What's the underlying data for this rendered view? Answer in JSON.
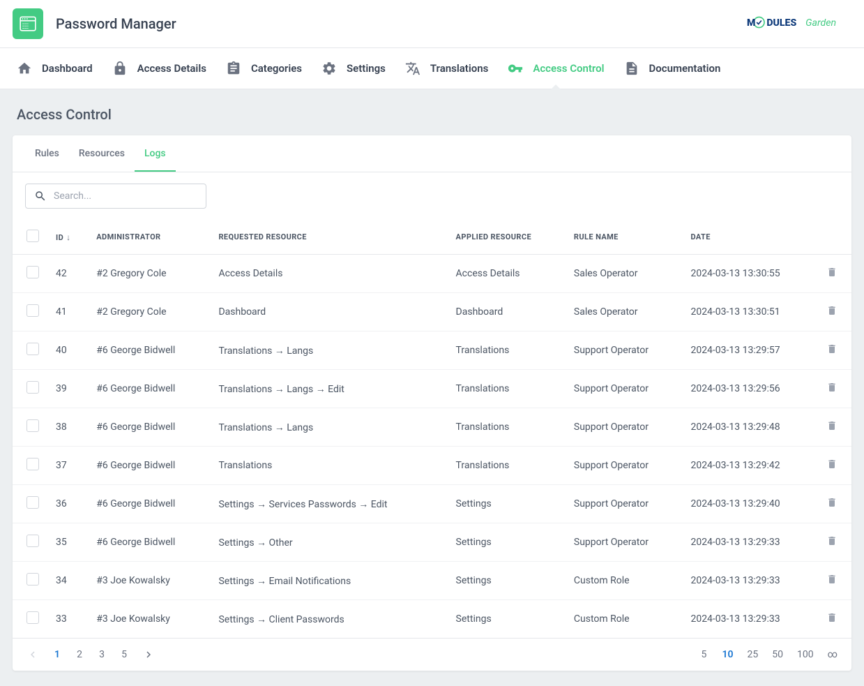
{
  "header": {
    "title": "Password Manager",
    "brand_modules": "MODULES",
    "brand_garden": "Garden"
  },
  "nav": {
    "items": [
      {
        "label": "Dashboard",
        "key": "dashboard"
      },
      {
        "label": "Access Details",
        "key": "access-details"
      },
      {
        "label": "Categories",
        "key": "categories"
      },
      {
        "label": "Settings",
        "key": "settings"
      },
      {
        "label": "Translations",
        "key": "translations"
      },
      {
        "label": "Access Control",
        "key": "access-control",
        "active": true
      },
      {
        "label": "Documentation",
        "key": "documentation"
      }
    ]
  },
  "page": {
    "title": "Access Control"
  },
  "tabs": {
    "items": [
      {
        "label": "Rules"
      },
      {
        "label": "Resources"
      },
      {
        "label": "Logs",
        "active": true
      }
    ]
  },
  "search": {
    "placeholder": "Search..."
  },
  "table": {
    "headers": {
      "id": "ID",
      "admin": "ADMINISTRATOR",
      "req": "REQUESTED RESOURCE",
      "app": "APPLIED RESOURCE",
      "rule": "RULE NAME",
      "date": "DATE"
    },
    "rows": [
      {
        "id": "42",
        "admin": "#2 Gregory Cole",
        "req": "Access Details",
        "app": "Access Details",
        "rule": "Sales Operator",
        "date": "2024-03-13 13:30:55"
      },
      {
        "id": "41",
        "admin": "#2 Gregory Cole",
        "req": "Dashboard",
        "app": "Dashboard",
        "rule": "Sales Operator",
        "date": "2024-03-13 13:30:51"
      },
      {
        "id": "40",
        "admin": "#6 George Bidwell",
        "req": "Translations → Langs",
        "app": "Translations",
        "rule": "Support Operator",
        "date": "2024-03-13 13:29:57"
      },
      {
        "id": "39",
        "admin": "#6 George Bidwell",
        "req": "Translations → Langs → Edit",
        "app": "Translations",
        "rule": "Support Operator",
        "date": "2024-03-13 13:29:56"
      },
      {
        "id": "38",
        "admin": "#6 George Bidwell",
        "req": "Translations → Langs",
        "app": "Translations",
        "rule": "Support Operator",
        "date": "2024-03-13 13:29:48"
      },
      {
        "id": "37",
        "admin": "#6 George Bidwell",
        "req": "Translations",
        "app": "Translations",
        "rule": "Support Operator",
        "date": "2024-03-13 13:29:42"
      },
      {
        "id": "36",
        "admin": "#6 George Bidwell",
        "req": "Settings → Services Passwords → Edit",
        "app": "Settings",
        "rule": "Support Operator",
        "date": "2024-03-13 13:29:40"
      },
      {
        "id": "35",
        "admin": "#6 George Bidwell",
        "req": "Settings → Other",
        "app": "Settings",
        "rule": "Support Operator",
        "date": "2024-03-13 13:29:33"
      },
      {
        "id": "34",
        "admin": "#3 Joe Kowalsky",
        "req": "Settings → Email Notifications",
        "app": "Settings",
        "rule": "Custom Role",
        "date": "2024-03-13 13:29:33"
      },
      {
        "id": "33",
        "admin": "#3 Joe Kowalsky",
        "req": "Settings → Client Passwords",
        "app": "Settings",
        "rule": "Custom Role",
        "date": "2024-03-13 13:29:33"
      }
    ]
  },
  "pagination": {
    "pages": [
      "1",
      "2",
      "3",
      "5"
    ],
    "current": "1",
    "sizes": [
      "5",
      "10",
      "25",
      "50",
      "100",
      "∞"
    ],
    "current_size": "10"
  }
}
